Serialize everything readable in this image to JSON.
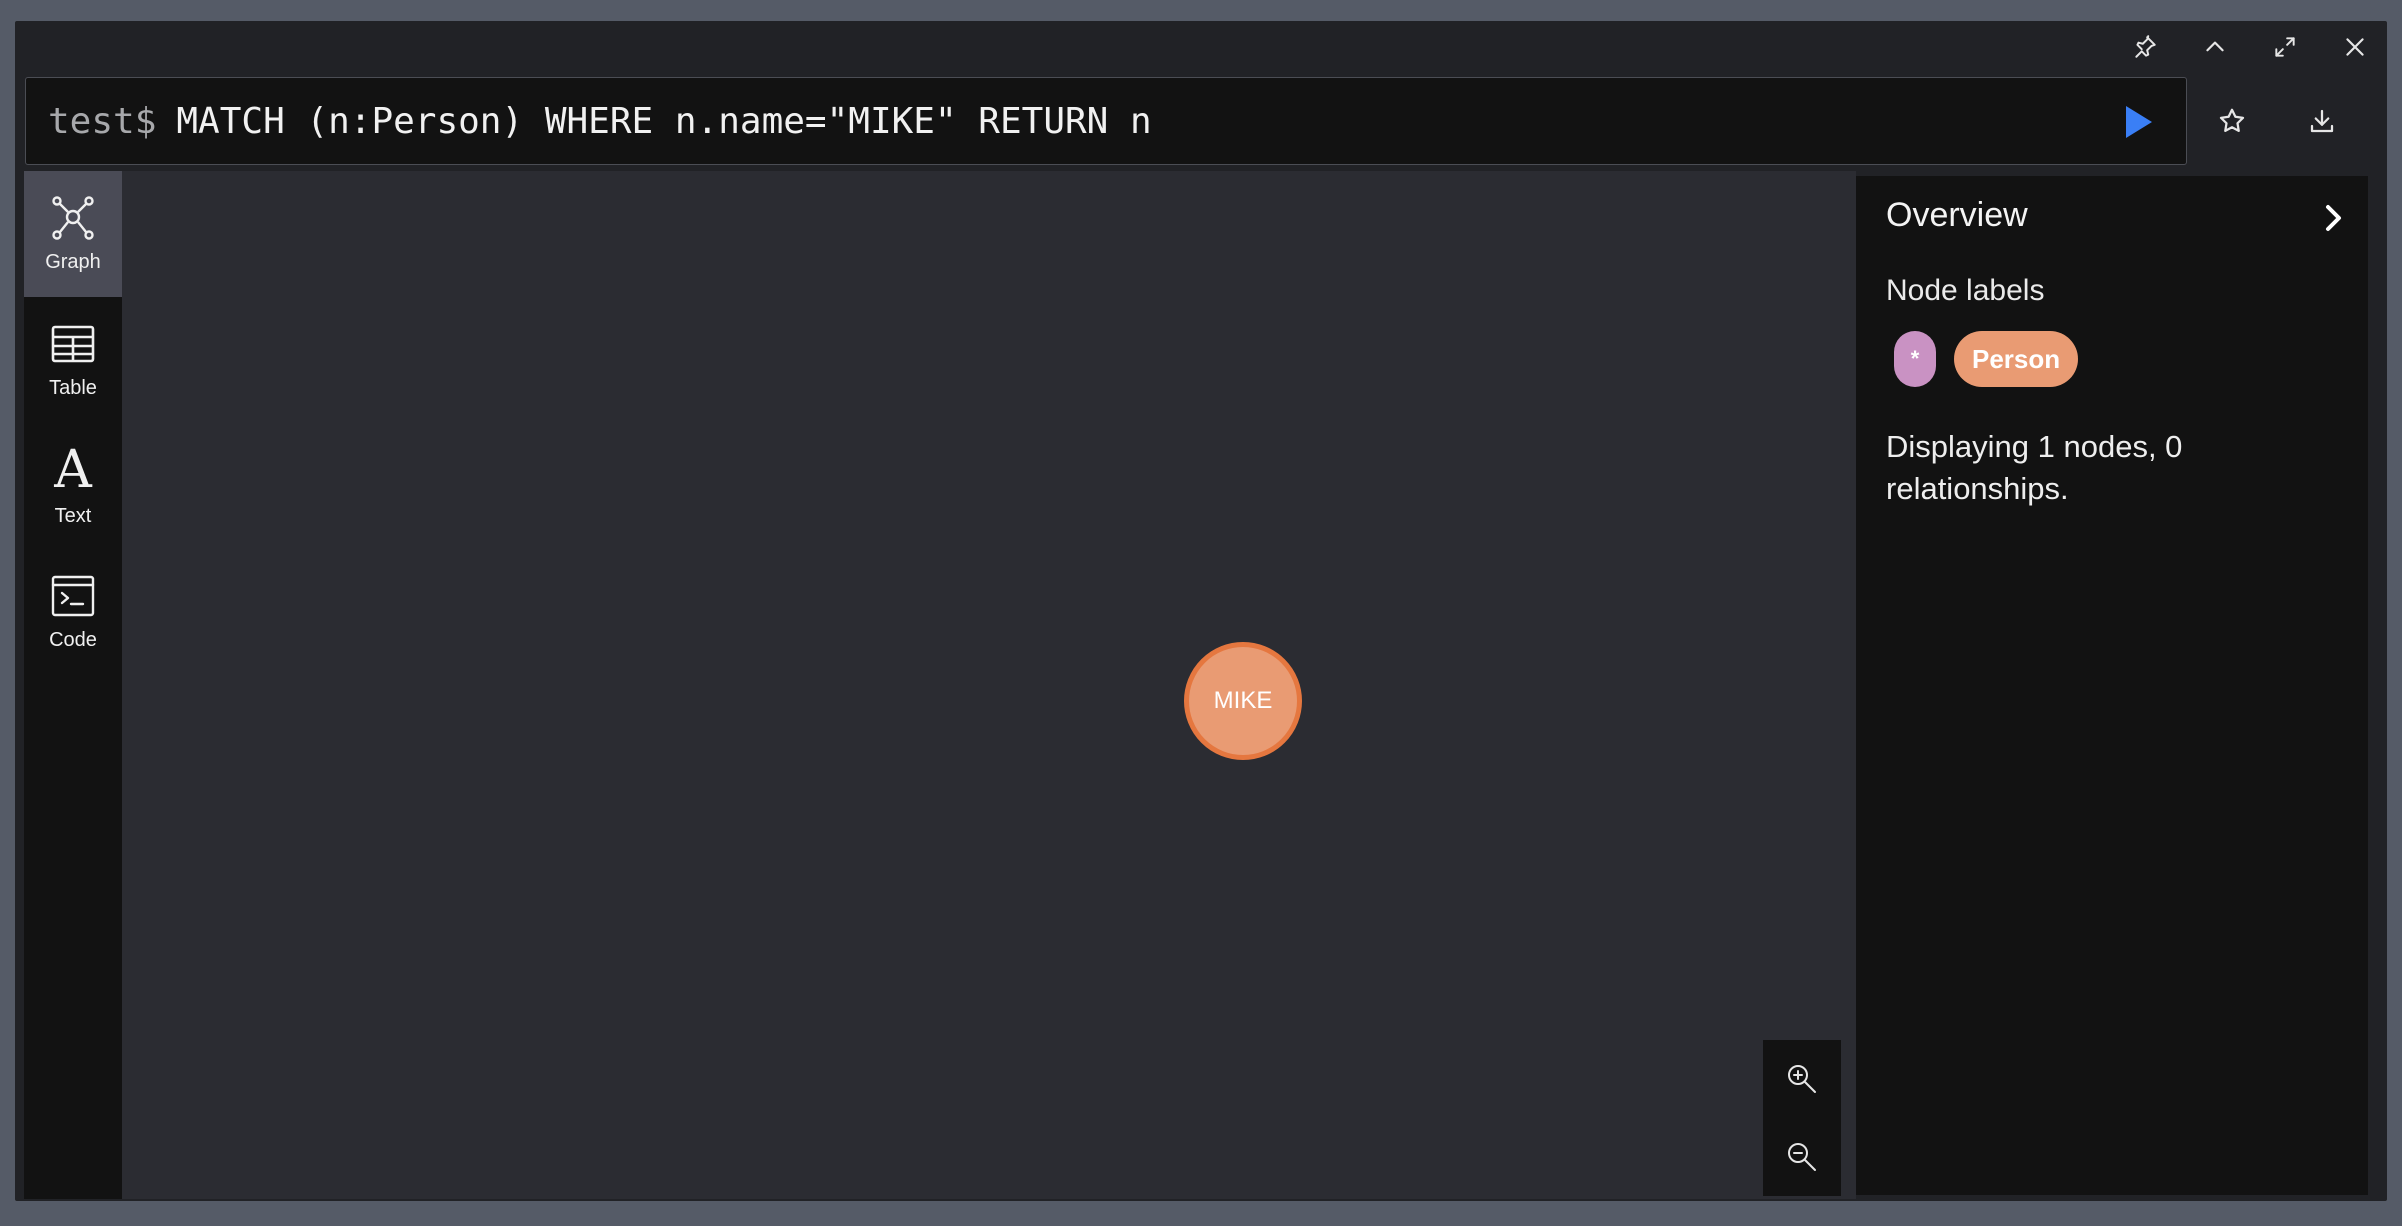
{
  "editor": {
    "prompt": "test$",
    "query": "MATCH (n:Person) WHERE n.name=\"MIKE\" RETURN n"
  },
  "topbar": {
    "icons": [
      "pin-icon",
      "collapse-up-icon",
      "fullscreen-icon",
      "close-icon"
    ]
  },
  "editor_actions": [
    "run-icon",
    "star-icon",
    "download-icon"
  ],
  "sidebar": {
    "items": [
      {
        "label": "Graph",
        "icon": "graph-icon",
        "active": true
      },
      {
        "label": "Table",
        "icon": "table-icon",
        "active": false
      },
      {
        "label": "Text",
        "icon": "text-icon",
        "active": false
      },
      {
        "label": "Code",
        "icon": "code-icon",
        "active": false
      }
    ]
  },
  "graph": {
    "nodes": [
      {
        "label": "MIKE",
        "color": "#e99b73",
        "border": "#e5773f"
      }
    ]
  },
  "zoom": [
    "zoom-in-icon",
    "zoom-out-icon"
  ],
  "overview": {
    "title": "Overview",
    "node_labels_heading": "Node labels",
    "labels": [
      {
        "text": "*",
        "color": "#c992c3"
      },
      {
        "text": "Person",
        "color": "#e99b73"
      }
    ],
    "status": "Displaying 1 nodes, 0 relationships."
  },
  "colors": {
    "accent": "#3a7ff6",
    "background": "#2b2c32",
    "panel": "#121212"
  }
}
